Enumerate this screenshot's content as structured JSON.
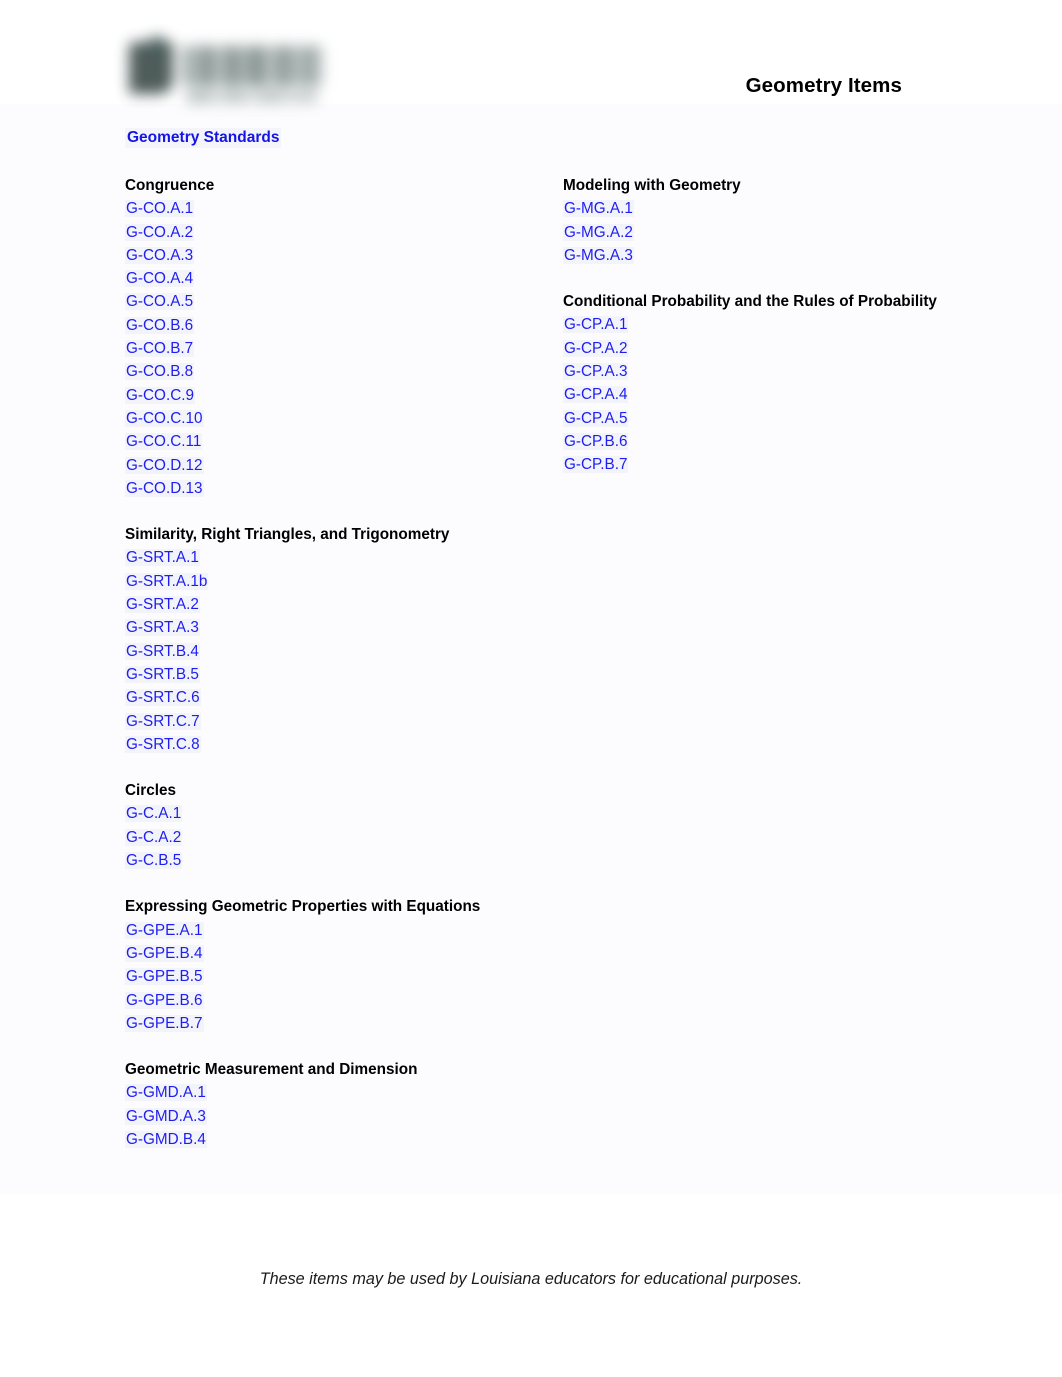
{
  "document": {
    "title": "Geometry Items",
    "logo_alt": "louisiana-believes-logo"
  },
  "standards_heading": "Geometry Standards",
  "columns": {
    "left": [
      {
        "heading": "Congruence",
        "standards": [
          "G-CO.A.1",
          "G-CO.A.2",
          "G-CO.A.3",
          "G-CO.A.4",
          "G-CO.A.5",
          "G-CO.B.6",
          "G-CO.B.7",
          "G-CO.B.8",
          "G-CO.C.9",
          "G-CO.C.10",
          "G-CO.C.11",
          "G-CO.D.12",
          "G-CO.D.13"
        ]
      },
      {
        "heading": "Similarity, Right Triangles, and Trigonometry",
        "standards": [
          "G-SRT.A.1",
          "G-SRT.A.1b",
          "G-SRT.A.2",
          "G-SRT.A.3",
          "G-SRT.B.4",
          "G-SRT.B.5",
          "G-SRT.C.6",
          "G-SRT.C.7",
          "G-SRT.C.8"
        ]
      },
      {
        "heading": "Circles",
        "standards": [
          "G-C.A.1",
          "G-C.A.2",
          "G-C.B.5"
        ]
      },
      {
        "heading": "Expressing Geometric Properties with Equations",
        "standards": [
          "G-GPE.A.1",
          "G-GPE.B.4",
          "G-GPE.B.5",
          "G-GPE.B.6",
          "G-GPE.B.7"
        ]
      },
      {
        "heading": "Geometric Measurement and Dimension",
        "standards": [
          "G-GMD.A.1",
          "G-GMD.A.3",
          "G-GMD.B.4"
        ]
      }
    ],
    "right": [
      {
        "heading": "Modeling with Geometry",
        "standards": [
          "G-MG.A.1",
          "G-MG.A.2",
          "G-MG.A.3"
        ]
      },
      {
        "heading": "Conditional Probability and the Rules of Probability",
        "standards": [
          "G-CP.A.1",
          "G-CP.A.2",
          "G-CP.A.3",
          "G-CP.A.4",
          "G-CP.A.5",
          "G-CP.B.6",
          "G-CP.B.7"
        ]
      }
    ]
  },
  "footer": {
    "note": "These items may be used by Louisiana educators for educational purposes."
  },
  "colors": {
    "link_blue": "#1e1ef0",
    "heading_blue": "#1414e6",
    "text_black": "#000000",
    "page_background": "#ffffff"
  }
}
